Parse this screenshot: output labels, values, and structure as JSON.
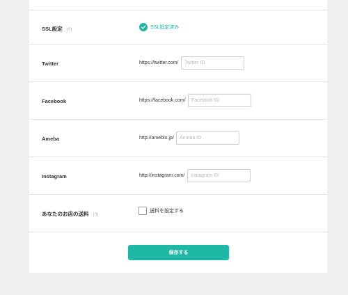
{
  "colors": {
    "accent": "#1fb7a5",
    "page_bg": "#efeff0",
    "panel_bg": "#ffffff"
  },
  "ssl": {
    "label": "SSL設定",
    "help": "(?)",
    "status": "SSL設定済み",
    "icon": "check-circle-icon"
  },
  "twitter": {
    "label": "Twitter",
    "prefix": "https://twitter.com/",
    "placeholder": "Twitter ID",
    "value": ""
  },
  "facebook": {
    "label": "Facebook",
    "prefix": "https://facebook.com/",
    "placeholder": "Facebook ID",
    "value": ""
  },
  "ameba": {
    "label": "Ameba",
    "prefix": "http://ameblo.jp/",
    "placeholder": "Ameba ID",
    "value": ""
  },
  "instagram": {
    "label": "Instagram",
    "prefix": "http://instagram.com/",
    "placeholder": "Instagram ID",
    "value": ""
  },
  "shipping": {
    "label": "あなたのお店の送料",
    "help": "(?)",
    "checkbox_label": "送料を設定する",
    "checked": false
  },
  "save_label": "保存する"
}
